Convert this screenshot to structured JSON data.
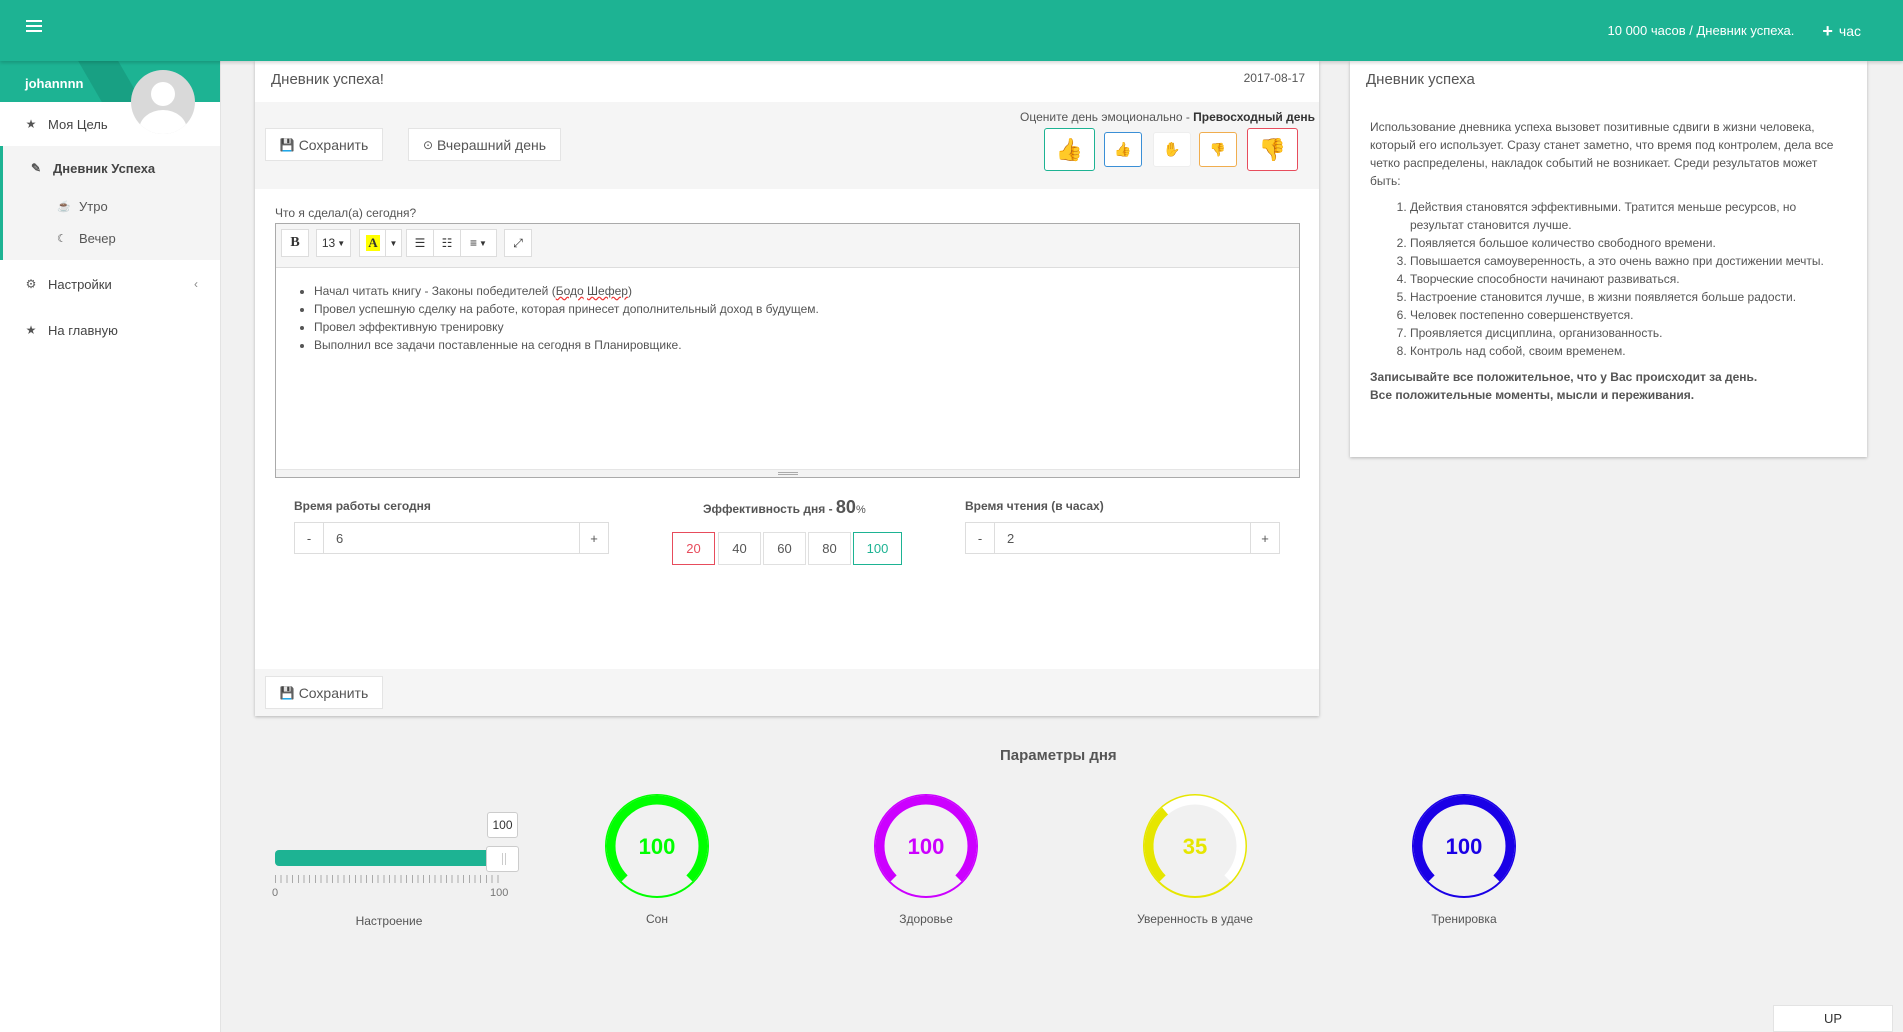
{
  "topbar": {
    "link": "10 000 часов / Дневник успеха.",
    "add_label": "час",
    "color": "#1db393"
  },
  "sidebar": {
    "user": "johannnn",
    "items": [
      {
        "label": "Моя Цель",
        "icon": "star-icon"
      },
      {
        "label": "Дневник Успеха",
        "icon": "edit-icon"
      },
      {
        "label": "Настройки",
        "icon": "gears-icon"
      },
      {
        "label": "На главную",
        "icon": "star-icon"
      }
    ],
    "subitems": [
      {
        "label": "Утро",
        "icon": "coffee-icon"
      },
      {
        "label": "Вечер",
        "icon": "moon-icon"
      }
    ]
  },
  "main": {
    "title": "Дневник успеха!",
    "date": "2017-08-17",
    "rate_prompt": "Оцените день эмоционально - ",
    "rate_value": "Превосходный день",
    "save_label": "Сохранить",
    "yesterday_label": "Вчерашний день",
    "editor_label": "Что я сделал(а) сегодня?",
    "font_size": "13",
    "entries": {
      "e1_pre": "Начал читать книгу -  Законы победителей (",
      "e1_a": "Бодо",
      "e1_b": "Шефер",
      "e1_post": ")",
      "e2": "Провел успешную сделку на работе, которая принесет дополнительный доход в будущем.",
      "e3": "Провел эффективную тренировку",
      "e4": "Выполнил все задачи поставленные на сегодня в Планировщике."
    },
    "work_label": "Время работы сегодня",
    "work_value": "6",
    "efficiency_label": "Эффективность дня - ",
    "efficiency_value": "80",
    "efficiency_unit": "%",
    "efficiency_options": [
      "20",
      "40",
      "60",
      "80",
      "100"
    ],
    "reading_label": "Время чтения (в часах)",
    "reading_value": "2",
    "minus": "-",
    "plus": "+"
  },
  "info": {
    "title": "Дневник успеха",
    "intro": "Использование дневника успеха вызовет позитивные сдвиги в жизни человека, который его использует. Сразу станет заметно, что время под контролем, дела все четко распределены, накладок событий не возникает. Среди результатов может быть:",
    "list": [
      "Действия становятся эффективными. Тратится меньше ресурсов, но результат становится лучше.",
      "Появляется большое количество свободного времени.",
      "Повышается самоуверенность, а это очень важно при достижении мечты.",
      "Творческие способности начинают развиваться.",
      "Настроение становится лучше, в жизни появляется больше радости.",
      "Человек постепенно совершенствуется.",
      "Проявляется дисциплина, организованность.",
      "Контроль над собой, своим временем."
    ],
    "outro1": "Записывайте все положительное, что у Вас происходит за день.",
    "outro2": "Все положительные моменты, мысли и переживания."
  },
  "params": {
    "title": "Параметры дня",
    "mood": {
      "label": "Настроение",
      "value": "100",
      "min": "0",
      "max": "100",
      "fraction": 1.0
    },
    "gauges": [
      {
        "label": "Сон",
        "value": "100",
        "color": "#00ff00",
        "fraction": 1.0
      },
      {
        "label": "Здоровье",
        "value": "100",
        "color": "#cc00ff",
        "fraction": 1.0
      },
      {
        "label": "Уверенность в удаче",
        "value": "35",
        "color": "#e6e600",
        "fraction": 0.35
      },
      {
        "label": "Тренировка",
        "value": "100",
        "color": "#1a00e6",
        "fraction": 1.0
      }
    ]
  },
  "up_label": "UP"
}
